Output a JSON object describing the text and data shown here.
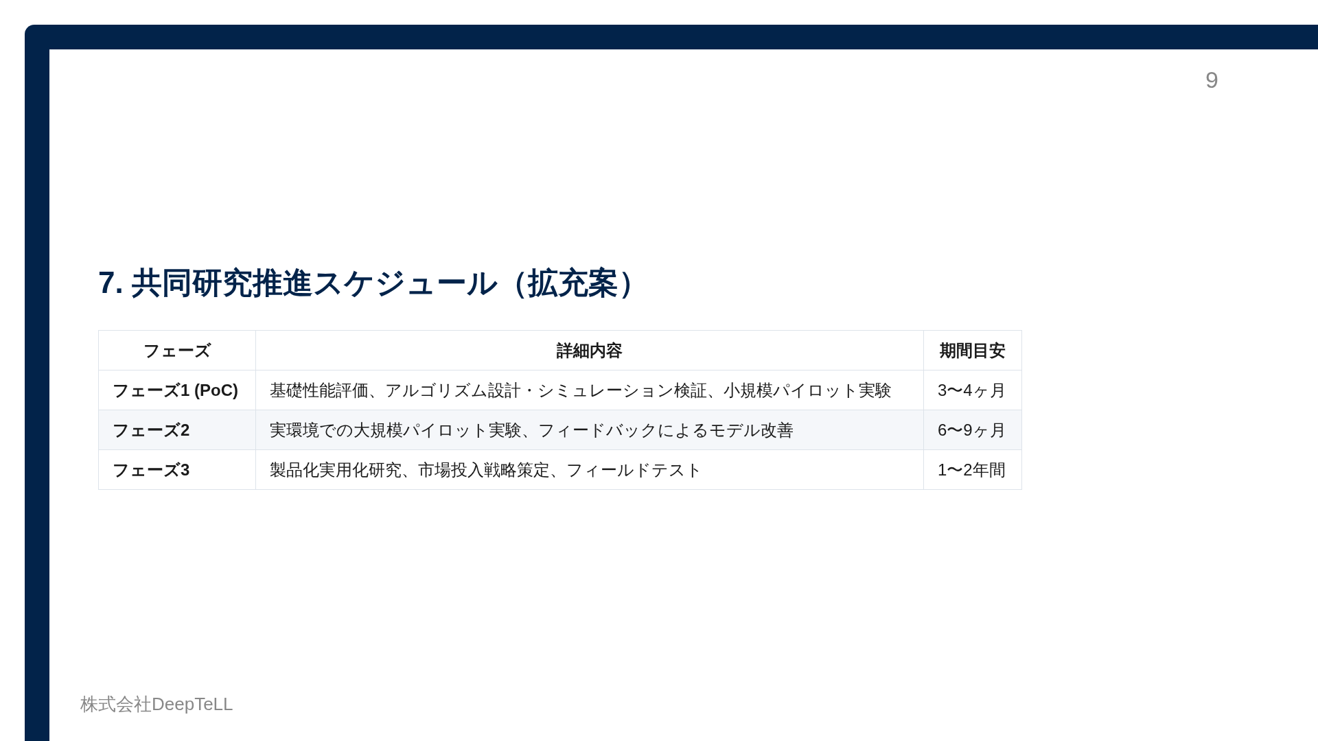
{
  "page_number": "9",
  "title": "7. 共同研究推進スケジュール（拡充案）",
  "table": {
    "columns": [
      "フェーズ",
      "詳細内容",
      "期間目安"
    ],
    "rows": [
      {
        "phase": "フェーズ1 (PoC)",
        "details": "基礎性能評価、アルゴリズム設計・シミュレーション検証、小規模パイロット実験",
        "duration": "3〜4ヶ月"
      },
      {
        "phase": "フェーズ2",
        "details": "実環境での大規模パイロット実験、フィードバックによるモデル改善",
        "duration": "6〜9ヶ月"
      },
      {
        "phase": "フェーズ3",
        "details": "製品化実用化研究、市場投入戦略策定、フィールドテスト",
        "duration": "1〜2年間"
      }
    ]
  },
  "footer": "株式会社DeepTeLL"
}
